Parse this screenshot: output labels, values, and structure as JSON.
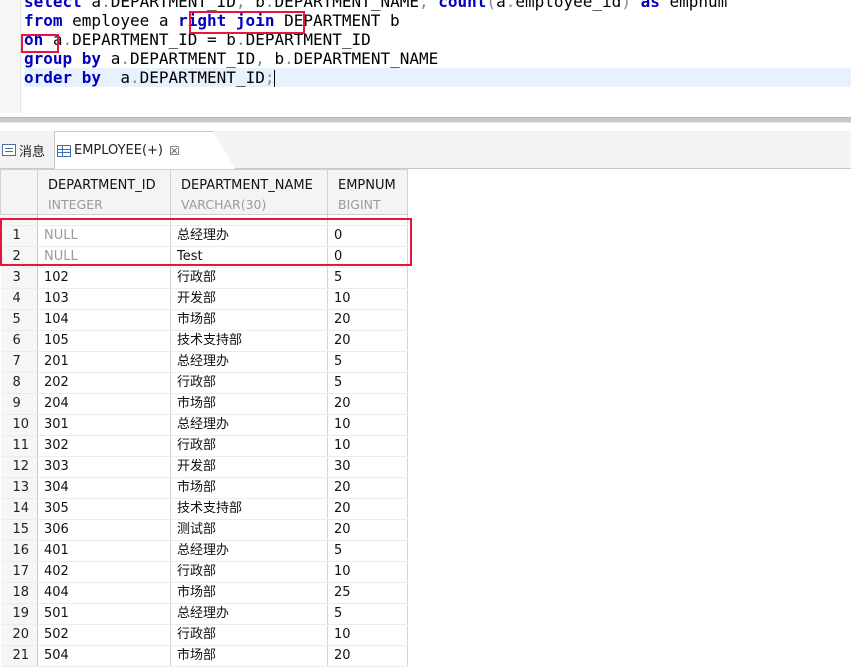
{
  "editor": {
    "lines": [
      {
        "tokens": [
          {
            "t": "select",
            "c": "kw"
          },
          {
            "t": " a",
            "c": "id"
          },
          {
            "t": ".",
            "c": "pun"
          },
          {
            "t": "DEPARTMENT_ID",
            "c": "id"
          },
          {
            "t": ", ",
            "c": "pun"
          },
          {
            "t": "b",
            "c": "id"
          },
          {
            "t": ".",
            "c": "pun"
          },
          {
            "t": "DEPARTMENT_NAME",
            "c": "id"
          },
          {
            "t": ", ",
            "c": "pun"
          },
          {
            "t": "count",
            "c": "kw"
          },
          {
            "t": "(",
            "c": "pun"
          },
          {
            "t": "a",
            "c": "id"
          },
          {
            "t": ".",
            "c": "pun"
          },
          {
            "t": "employee_id",
            "c": "id"
          },
          {
            "t": ")",
            "c": "pun"
          },
          {
            "t": " ",
            "c": "id"
          },
          {
            "t": "as",
            "c": "kw"
          },
          {
            "t": " empnum",
            "c": "id"
          }
        ]
      },
      {
        "tokens": [
          {
            "t": "from",
            "c": "kw"
          },
          {
            "t": " employee a ",
            "c": "id"
          },
          {
            "t": "right join",
            "c": "kw"
          },
          {
            "t": " DEPARTMENT b",
            "c": "id"
          }
        ]
      },
      {
        "tokens": [
          {
            "t": "on",
            "c": "kw"
          },
          {
            "t": " a",
            "c": "id"
          },
          {
            "t": ".",
            "c": "pun"
          },
          {
            "t": "DEPARTMENT_ID = b",
            "c": "id"
          },
          {
            "t": ".",
            "c": "pun"
          },
          {
            "t": "DEPARTMENT_ID",
            "c": "id"
          }
        ]
      },
      {
        "tokens": [
          {
            "t": "group by",
            "c": "kw"
          },
          {
            "t": " a",
            "c": "id"
          },
          {
            "t": ".",
            "c": "pun"
          },
          {
            "t": "DEPARTMENT_ID",
            "c": "id"
          },
          {
            "t": ", ",
            "c": "pun"
          },
          {
            "t": "b",
            "c": "id"
          },
          {
            "t": ".",
            "c": "pun"
          },
          {
            "t": "DEPARTMENT_NAME",
            "c": "id"
          }
        ]
      },
      {
        "tokens": [
          {
            "t": "order by",
            "c": "kw"
          },
          {
            "t": "  a",
            "c": "id"
          },
          {
            "t": ".",
            "c": "pun"
          },
          {
            "t": "DEPARTMENT_ID",
            "c": "id"
          },
          {
            "t": ";",
            "c": "pun"
          }
        ]
      }
    ]
  },
  "tabs": {
    "messages_label": "消息",
    "result_label": "EMPLOYEE(+)",
    "close_glyph": "☒"
  },
  "grid": {
    "columns": [
      {
        "name": "DEPARTMENT_ID",
        "type": "INTEGER"
      },
      {
        "name": "DEPARTMENT_NAME",
        "type": "VARCHAR(30)"
      },
      {
        "name": "EMPNUM",
        "type": "BIGINT"
      }
    ],
    "rows": [
      [
        "1",
        "NULL",
        "总经理办",
        "0"
      ],
      [
        "2",
        "NULL",
        "Test",
        "0"
      ],
      [
        "3",
        "102",
        "行政部",
        "5"
      ],
      [
        "4",
        "103",
        "开发部",
        "10"
      ],
      [
        "5",
        "104",
        "市场部",
        "20"
      ],
      [
        "6",
        "105",
        "技术支持部",
        "20"
      ],
      [
        "7",
        "201",
        "总经理办",
        "5"
      ],
      [
        "8",
        "202",
        "行政部",
        "5"
      ],
      [
        "9",
        "204",
        "市场部",
        "20"
      ],
      [
        "10",
        "301",
        "总经理办",
        "10"
      ],
      [
        "11",
        "302",
        "行政部",
        "10"
      ],
      [
        "12",
        "303",
        "开发部",
        "30"
      ],
      [
        "13",
        "304",
        "市场部",
        "20"
      ],
      [
        "14",
        "305",
        "技术支持部",
        "20"
      ],
      [
        "15",
        "306",
        "测试部",
        "20"
      ],
      [
        "16",
        "401",
        "总经理办",
        "5"
      ],
      [
        "17",
        "402",
        "行政部",
        "10"
      ],
      [
        "18",
        "404",
        "市场部",
        "25"
      ],
      [
        "19",
        "501",
        "总经理办",
        "5"
      ],
      [
        "20",
        "502",
        "行政部",
        "10"
      ],
      [
        "21",
        "504",
        "市场部",
        "20"
      ]
    ]
  },
  "colors": {
    "keyword": "#0000c0",
    "highlight_box": "#e8143c",
    "null_text": "#9a9a9a"
  }
}
